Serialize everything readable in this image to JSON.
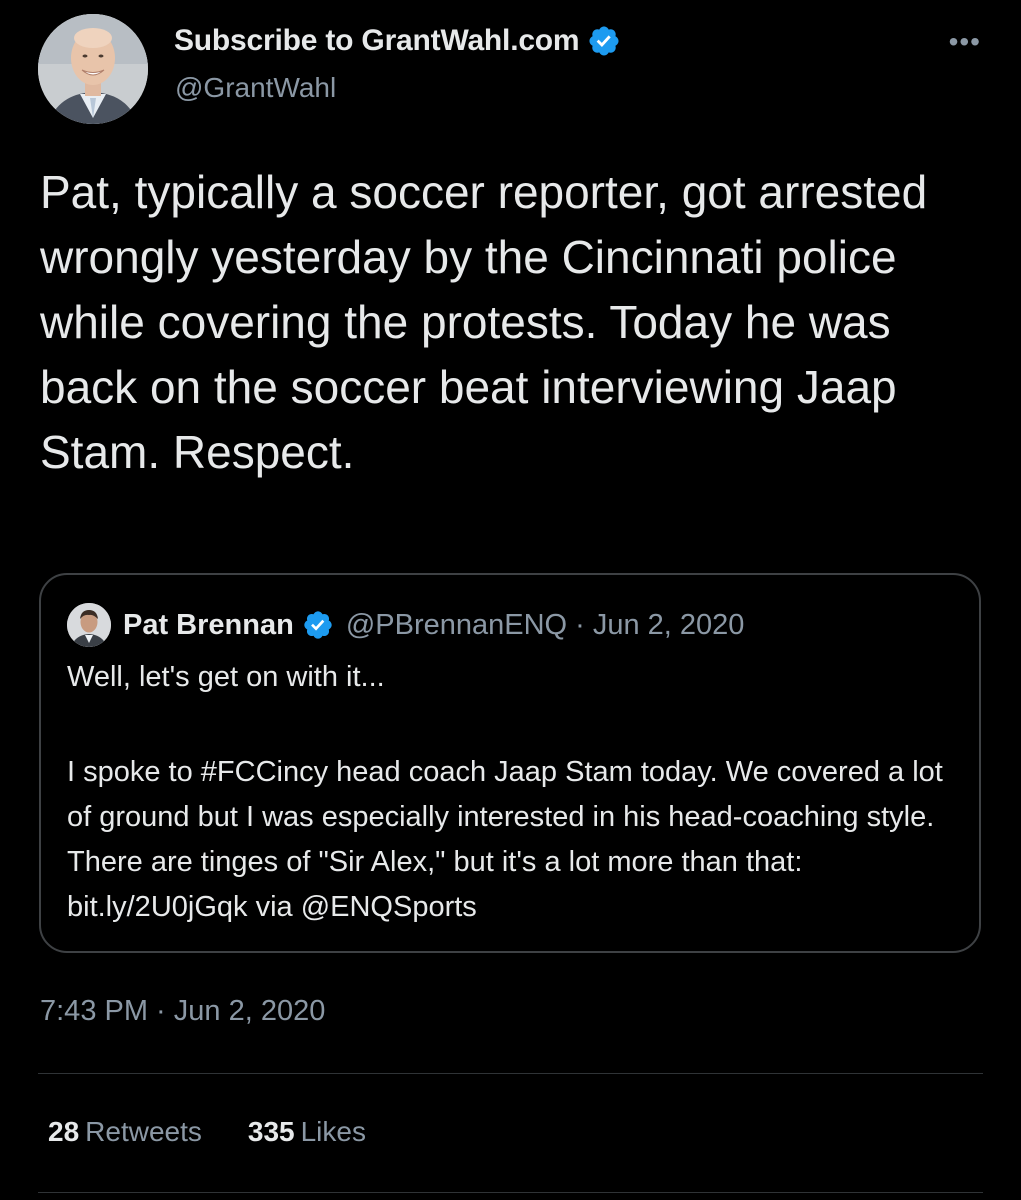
{
  "tweet": {
    "author": {
      "display_name": "Subscribe to GrantWahl.com",
      "handle": "@GrantWahl",
      "verified": true,
      "avatar_icon": "profile-photo"
    },
    "more_icon": "•••",
    "text": "Pat, typically a soccer reporter, got arrested wrongly yesterday by the Cincinnati police while covering the protests. Today he was back on the soccer beat interviewing Jaap Stam. Respect.",
    "timestamp": "7:43 PM · Jun 2, 2020",
    "stats": {
      "retweets_count": "28",
      "retweets_label": "Retweets",
      "likes_count": "335",
      "likes_label": "Likes"
    }
  },
  "quoted_tweet": {
    "author": {
      "display_name": "Pat Brennan",
      "verified": true,
      "handle_date": "@PBrennanENQ · Jun 2, 2020"
    },
    "line1": "Well, let's get on with it...",
    "paragraph": "I spoke to #FCCincy head coach Jaap Stam today. We covered a lot of ground but I was especially interested in his head-coaching style. There are tinges of \"Sir Alex,\" but it's a lot more than that: bit.ly/2U0jGqk via @ENQSports"
  },
  "colors": {
    "background": "#000000",
    "text_primary": "#e7e9ea",
    "text_secondary": "#8b98a5",
    "verified_blue": "#1d9bf0",
    "border": "#3e4144"
  }
}
